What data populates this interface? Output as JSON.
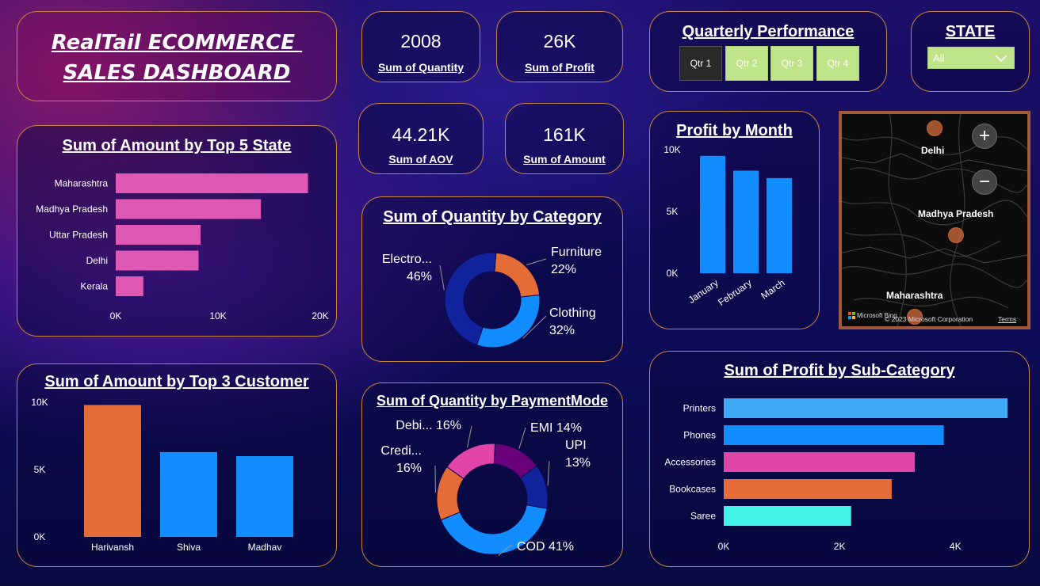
{
  "dashboard": {
    "title_line1": "RealTail ECOMMERCE ",
    "title_line2": "SALES DASHBOARD"
  },
  "kpis": {
    "quantity": {
      "value": "2008",
      "label": "Sum of Quantity"
    },
    "profit": {
      "value": "26K",
      "label": "Sum of Profit"
    },
    "aov": {
      "value": "44.21K",
      "label": "Sum of AOV"
    },
    "amount": {
      "value": "161K",
      "label": "Sum of Amount"
    }
  },
  "quarter_filter": {
    "title": "Quarterly Performance",
    "options": [
      "Qtr 1",
      "Qtr 2",
      "Qtr 3",
      "Qtr 4"
    ],
    "selected": "Qtr 1"
  },
  "state_filter": {
    "title": "STATE",
    "selected": "All"
  },
  "map": {
    "labels": [
      "Delhi",
      "Madhya Pradesh",
      "Maharashtra"
    ],
    "attribution": "© 2023 Microsoft Corporation",
    "terms": "Terms",
    "brand": "Microsoft Bing",
    "zoom_in": "+",
    "zoom_out": "−"
  },
  "colors": {
    "pink_bar": "#de58b4",
    "blue_bar": "#118dff",
    "orange_bar": "#e66c37",
    "navy": "#12239e",
    "purple": "#6b007b",
    "magenta": "#e044a7",
    "cyan": "#41f2e6",
    "light_blue": "#3fa9f5",
    "card_border": "#c7843d"
  },
  "chart_data": [
    {
      "id": "top5state",
      "type": "bar",
      "orientation": "horizontal",
      "title": "Sum of Amount by Top 5 State",
      "categories": [
        "Maharashtra",
        "Madhya Pradesh",
        "Uttar Pradesh",
        "Delhi",
        "Kerala"
      ],
      "values": [
        18800,
        14200,
        8300,
        8100,
        2700
      ],
      "xlim": [
        0,
        20000
      ],
      "ticks": [
        0,
        10000,
        20000
      ],
      "tick_labels": [
        "0K",
        "10K",
        "20K"
      ],
      "color": "#de58b4",
      "grid": false
    },
    {
      "id": "top3customer",
      "type": "bar",
      "orientation": "vertical",
      "title": "Sum of Amount by Top 3 Customer",
      "categories": [
        "Harivansh",
        "Shiva",
        "Madhav"
      ],
      "values": [
        9800,
        6300,
        6000
      ],
      "colors": [
        "#e66c37",
        "#118dff",
        "#118dff"
      ],
      "ylim": [
        0,
        10000
      ],
      "ticks": [
        0,
        5000,
        10000
      ],
      "tick_labels": [
        "0K",
        "5K",
        "10K"
      ],
      "grid": false
    },
    {
      "id": "qty_category",
      "type": "pie",
      "donut": true,
      "title": "Sum of Quantity by Category",
      "slices": [
        {
          "name": "Furniture",
          "label": "Furniture",
          "pct_label": "22%",
          "value": 22,
          "color": "#e66c37"
        },
        {
          "name": "Clothing",
          "label": "Clothing",
          "pct_label": "32%",
          "value": 32,
          "color": "#118dff"
        },
        {
          "name": "Electronics",
          "label": "Electro...",
          "pct_label": "46%",
          "value": 46,
          "color": "#12239e"
        }
      ]
    },
    {
      "id": "qty_payment",
      "type": "pie",
      "donut": true,
      "title": "Sum of Quantity by PaymentMode",
      "slices": [
        {
          "name": "EMI",
          "label": "EMI 14%",
          "value": 14,
          "color": "#6b007b"
        },
        {
          "name": "UPI",
          "label": "UPI",
          "pct_label": "13%",
          "value": 13,
          "color": "#12239e"
        },
        {
          "name": "COD",
          "label": "COD 41%",
          "value": 41,
          "color": "#118dff"
        },
        {
          "name": "Credit Card",
          "label": "Credi...",
          "pct_label": "16%",
          "value": 16,
          "color": "#e66c37"
        },
        {
          "name": "Debit Card",
          "label": "Debi... 16%",
          "value": 16,
          "color": "#e044a7"
        }
      ]
    },
    {
      "id": "profit_month",
      "type": "bar",
      "orientation": "vertical",
      "title": "Profit by Month",
      "categories": [
        "January",
        "February",
        "March"
      ],
      "values": [
        9500,
        8300,
        7700
      ],
      "color": "#118dff",
      "ylim": [
        0,
        10000
      ],
      "ticks": [
        0,
        5000,
        10000
      ],
      "tick_labels": [
        "0K",
        "5K",
        "10K"
      ],
      "grid": false
    },
    {
      "id": "profit_subcat",
      "type": "bar",
      "orientation": "horizontal",
      "title": "Sum of Profit by Sub-Category",
      "categories": [
        "Printers",
        "Phones",
        "Accessories",
        "Bookcases",
        "Saree"
      ],
      "values": [
        4900,
        3800,
        3300,
        2900,
        2200
      ],
      "colors": [
        "#3fa9f5",
        "#118dff",
        "#e044a7",
        "#e66c37",
        "#41f2e6"
      ],
      "xlim": [
        0,
        4900
      ],
      "ticks": [
        0,
        2000,
        4000
      ],
      "tick_labels": [
        "0K",
        "2K",
        "4K"
      ],
      "grid": false
    }
  ]
}
